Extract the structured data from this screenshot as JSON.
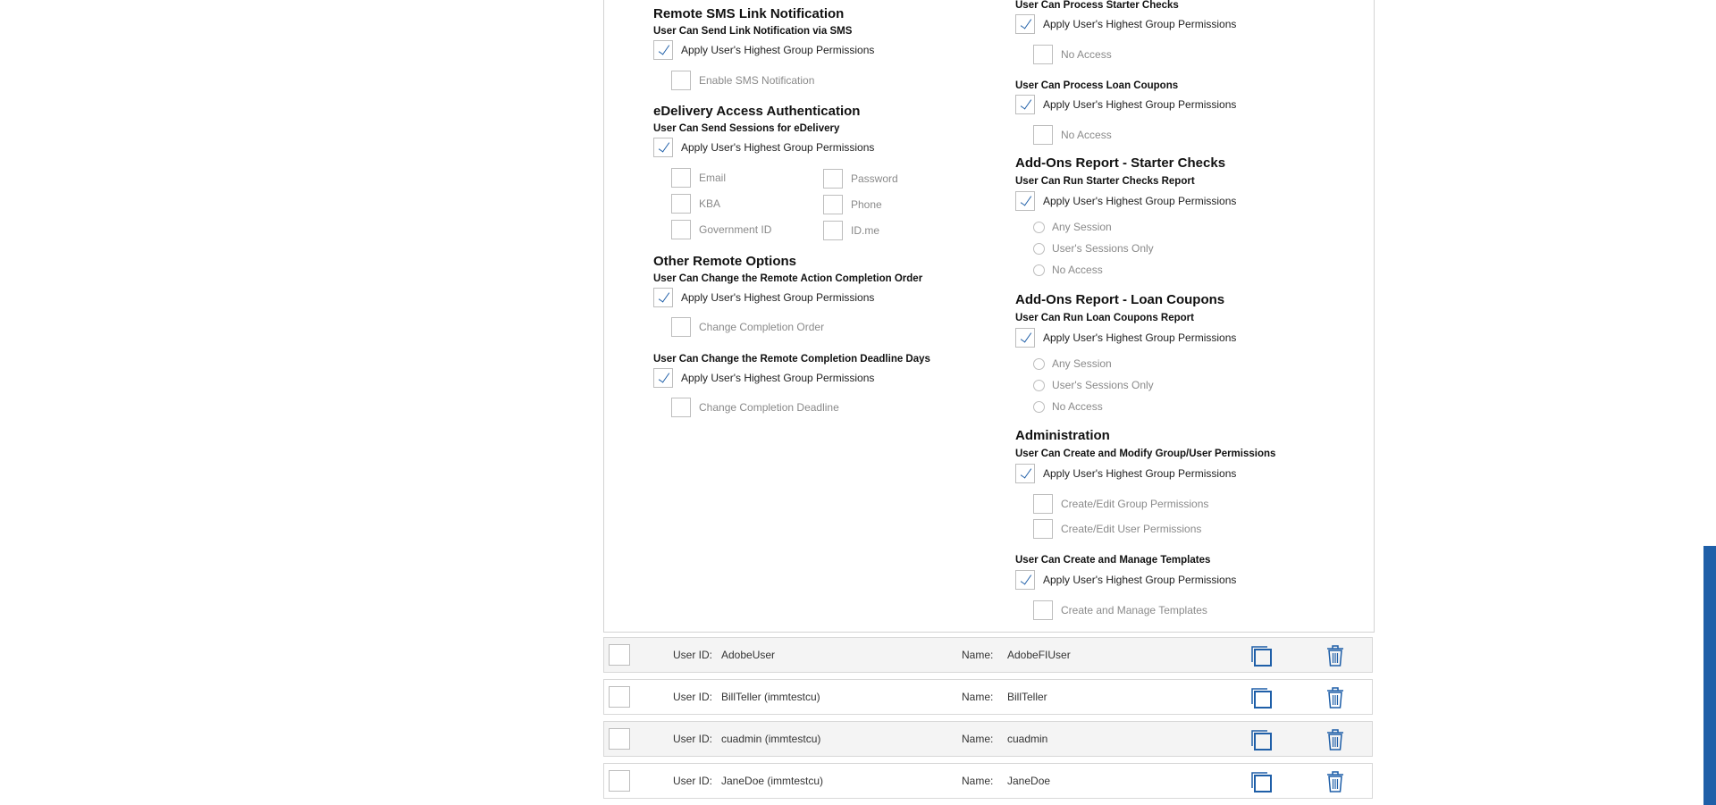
{
  "left": {
    "sms": {
      "title": "Remote SMS Link Notification",
      "sub": "User Can Send Link Notification via SMS",
      "apply": "Apply User's Highest Group Permissions",
      "opt": "Enable SMS Notification"
    },
    "edelivery": {
      "title": "eDelivery Access Authentication",
      "sub": "User Can Send Sessions for eDelivery",
      "apply": "Apply User's Highest Group Permissions",
      "options": [
        "Email",
        "Password",
        "KBA",
        "Phone",
        "Government ID",
        "ID.me"
      ]
    },
    "other": {
      "title": "Other Remote Options",
      "sub1": "User Can Change the Remote Action Completion Order",
      "apply1": "Apply User's Highest Group Permissions",
      "opt1": "Change Completion Order",
      "sub2": "User Can Change the Remote Completion Deadline Days",
      "apply2": "Apply User's Highest Group Permissions",
      "opt2": "Change Completion Deadline"
    }
  },
  "right": {
    "starter": {
      "sub": "User Can Process Starter Checks",
      "apply": "Apply User's Highest Group Permissions",
      "opt": "No Access"
    },
    "coupons": {
      "sub": "User Can Process Loan Coupons",
      "apply": "Apply User's Highest Group Permissions",
      "opt": "No Access"
    },
    "starter_report": {
      "title": "Add-Ons Report - Starter Checks",
      "sub": "User Can Run Starter Checks Report",
      "apply": "Apply User's Highest Group Permissions",
      "radios": [
        "Any Session",
        "User's Sessions Only",
        "No Access"
      ]
    },
    "coupon_report": {
      "title": "Add-Ons Report - Loan Coupons",
      "sub": "User Can Run Loan Coupons Report",
      "apply": "Apply User's Highest Group Permissions",
      "radios": [
        "Any Session",
        "User's Sessions Only",
        "No Access"
      ]
    },
    "admin": {
      "title": "Administration",
      "sub1": "User Can Create and Modify Group/User Permissions",
      "apply1": "Apply User's Highest Group Permissions",
      "opt1a": "Create/Edit Group Permissions",
      "opt1b": "Create/Edit User Permissions",
      "sub2": "User Can Create and Manage Templates",
      "apply2": "Apply User's Highest Group Permissions",
      "opt2": "Create and Manage Templates"
    }
  },
  "users": {
    "userid_label": "User ID:",
    "name_label": "Name:",
    "rows": [
      {
        "id": "AdobeUser",
        "name": "AdobeFIUser"
      },
      {
        "id": "BillTeller (immtestcu)",
        "name": "BillTeller"
      },
      {
        "id": "cuadmin (immtestcu)",
        "name": "cuadmin"
      },
      {
        "id": "JaneDoe (immtestcu)",
        "name": "JaneDoe"
      }
    ]
  },
  "colors": {
    "accent": "#1f5fa8",
    "muted": "#8a8a8a",
    "border": "#d3d3d3"
  }
}
